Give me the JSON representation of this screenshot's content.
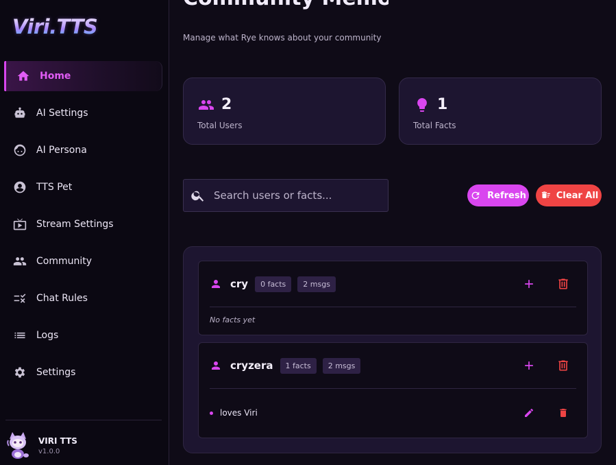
{
  "app": {
    "logo_text": "Viri.TTS",
    "brand_name": "VIRI TTS",
    "version": "v1.0.0"
  },
  "sidebar": {
    "items": [
      {
        "label": "Home",
        "icon": "home-icon",
        "active": true
      },
      {
        "label": "AI Settings",
        "icon": "robot-icon"
      },
      {
        "label": "AI Persona",
        "icon": "face-icon"
      },
      {
        "label": "TTS Pet",
        "icon": "account-circle-icon"
      },
      {
        "label": "Stream Settings",
        "icon": "live-tv-icon"
      },
      {
        "label": "Community",
        "icon": "people-icon"
      },
      {
        "label": "Chat Rules",
        "icon": "rule-icon"
      },
      {
        "label": "Logs",
        "icon": "list-icon"
      },
      {
        "label": "Settings",
        "icon": "gear-icon"
      }
    ]
  },
  "header": {
    "title": "Community Memory",
    "subtitle": "Manage what Rye knows about your community"
  },
  "stats": [
    {
      "value": "2",
      "label": "Total Users",
      "icon": "users-icon"
    },
    {
      "value": "1",
      "label": "Total Facts",
      "icon": "lightbulb-icon"
    }
  ],
  "search": {
    "placeholder": "Search users or facts...",
    "value": ""
  },
  "actions": {
    "refresh_label": "Refresh",
    "clear_label": "Clear All"
  },
  "users": [
    {
      "name": "cry",
      "facts_badge": "0 facts",
      "msgs_badge": "2 msgs",
      "empty_text": "No facts yet",
      "facts": []
    },
    {
      "name": "cryzera",
      "facts_badge": "1 facts",
      "msgs_badge": "2 msgs",
      "facts": [
        {
          "text": "loves Viri"
        }
      ]
    }
  ],
  "colors": {
    "accent": "#d946ef",
    "danger": "#ef4444",
    "background": "#0f0b17",
    "card": "#1d1530"
  }
}
